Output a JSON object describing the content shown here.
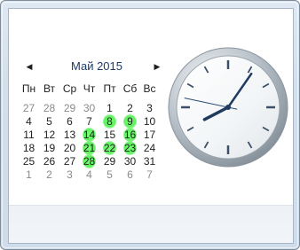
{
  "calendar": {
    "month_label": "Май 2015",
    "prev_icon": "◀",
    "next_icon": "▶",
    "weekdays": [
      "Пн",
      "Вт",
      "Ср",
      "Чт",
      "Пт",
      "Сб",
      "Вс"
    ],
    "weeks": [
      [
        {
          "d": "27",
          "other": true
        },
        {
          "d": "28",
          "other": true
        },
        {
          "d": "29",
          "other": true
        },
        {
          "d": "30",
          "other": true
        },
        {
          "d": "1"
        },
        {
          "d": "2"
        },
        {
          "d": "3"
        }
      ],
      [
        {
          "d": "4"
        },
        {
          "d": "5"
        },
        {
          "d": "6"
        },
        {
          "d": "7"
        },
        {
          "d": "8",
          "hl": true
        },
        {
          "d": "9",
          "hl": true
        },
        {
          "d": "10"
        }
      ],
      [
        {
          "d": "11"
        },
        {
          "d": "12"
        },
        {
          "d": "13"
        },
        {
          "d": "14",
          "hl": true
        },
        {
          "d": "15"
        },
        {
          "d": "16",
          "hl": true
        },
        {
          "d": "17"
        }
      ],
      [
        {
          "d": "18"
        },
        {
          "d": "19"
        },
        {
          "d": "20"
        },
        {
          "d": "21",
          "hl": true
        },
        {
          "d": "22",
          "hl": true
        },
        {
          "d": "23",
          "hl": true
        },
        {
          "d": "24"
        }
      ],
      [
        {
          "d": "25"
        },
        {
          "d": "26"
        },
        {
          "d": "27"
        },
        {
          "d": "28",
          "hl": true
        },
        {
          "d": "29"
        },
        {
          "d": "30"
        },
        {
          "d": "31"
        }
      ],
      [
        {
          "d": "1",
          "other": true
        },
        {
          "d": "2",
          "other": true
        },
        {
          "d": "3",
          "other": true
        },
        {
          "d": "4",
          "other": true
        },
        {
          "d": "5",
          "other": true
        },
        {
          "d": "6",
          "other": true
        },
        {
          "d": "7",
          "other": true
        }
      ]
    ],
    "highlight_color": "#5ef05e"
  },
  "clock": {
    "hour": 8,
    "minute": 5,
    "second": 47
  }
}
